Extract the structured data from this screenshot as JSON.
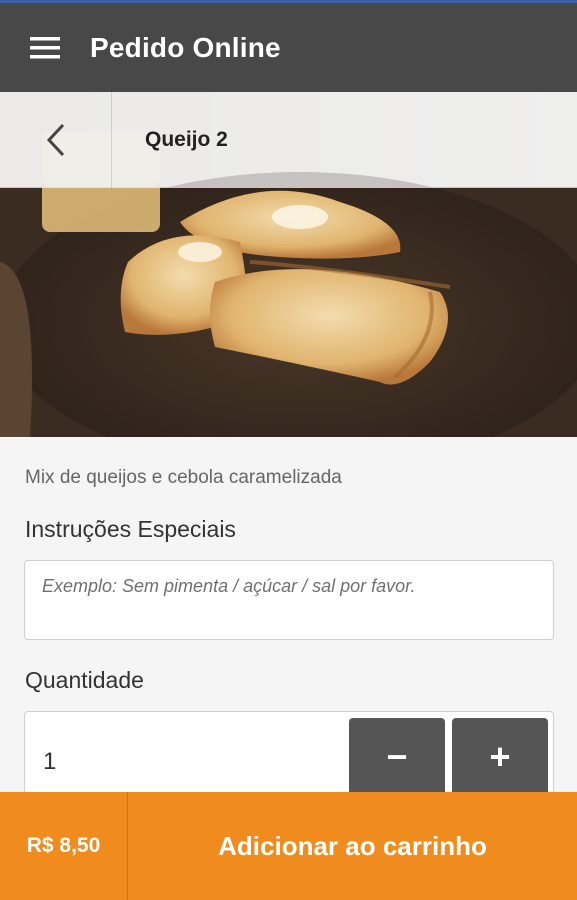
{
  "app": {
    "title": "Pedido Online"
  },
  "icons": {
    "menu": "menu-icon",
    "back": "chevron-left-icon",
    "minus": "minus-icon",
    "plus": "plus-icon"
  },
  "item": {
    "name": "Queijo 2",
    "description": "Mix de queijos e cebola caramelizada"
  },
  "instructions": {
    "label": "Instruções Especiais",
    "placeholder": "Exemplo: Sem pimenta / açúcar / sal por favor.",
    "value": ""
  },
  "quantity": {
    "label": "Quantidade",
    "value": "1",
    "minus_label": "−",
    "plus_label": "+"
  },
  "footer": {
    "price": "R$ 8,50",
    "add_label": "Adicionar ao carrinho"
  },
  "colors": {
    "app_bar": "#484848",
    "accent": "#ef8c1d",
    "top_accent": "#3d5fa8",
    "qty_button": "#555555"
  }
}
